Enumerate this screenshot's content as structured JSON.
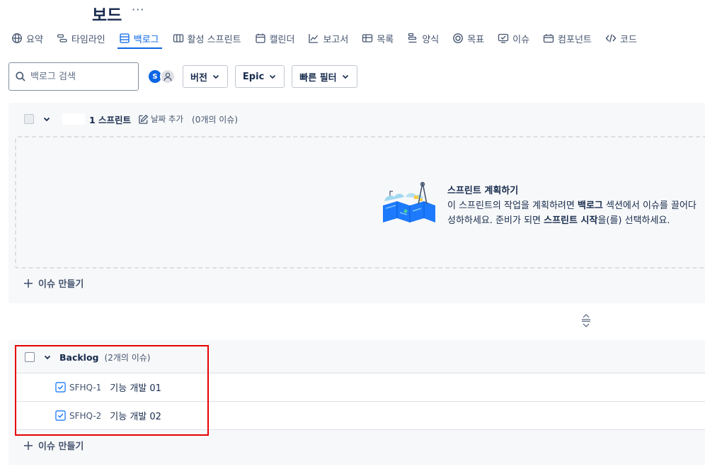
{
  "header": {
    "title": "보드",
    "more": "···"
  },
  "tabs": [
    {
      "label": "요약",
      "icon": "globe-icon"
    },
    {
      "label": "타임라인",
      "icon": "timeline-icon"
    },
    {
      "label": "백로그",
      "icon": "backlog-icon",
      "active": true
    },
    {
      "label": "활성 스프린트",
      "icon": "board-columns-icon"
    },
    {
      "label": "캘린더",
      "icon": "calendar-icon"
    },
    {
      "label": "보고서",
      "icon": "chart-line-icon"
    },
    {
      "label": "목록",
      "icon": "list-icon"
    },
    {
      "label": "양식",
      "icon": "form-icon"
    },
    {
      "label": "목표",
      "icon": "target-icon"
    },
    {
      "label": "이슈",
      "icon": "issue-icon"
    },
    {
      "label": "컴포넌트",
      "icon": "component-icon"
    },
    {
      "label": "코드",
      "icon": "code-icon"
    }
  ],
  "toolbar": {
    "search_placeholder": "백로그 검색",
    "avatar_initial": "S",
    "filters": [
      "버전",
      "Epic",
      "빠른 필터"
    ]
  },
  "sprint": {
    "name": "1 스프린트",
    "date_add": "날짜 추가",
    "count": "(0개의 이슈)",
    "plan_title": "스프린트 계획하기",
    "plan_desc_1": "이 스프린트의 작업을 계획하려면 ",
    "plan_desc_bold_1": "백로그",
    "plan_desc_2": " 섹션에서 이슈를 끌어다",
    "plan_desc_3": "성하하세요. 준비가 되면 ",
    "plan_desc_bold_2": "스프린트 시작",
    "plan_desc_4": "을(를) 선택하세요.",
    "create_issue": "이슈 만들기"
  },
  "backlog": {
    "name": "Backlog",
    "count": "(2개의 이슈)",
    "issues": [
      {
        "key": "SFHQ-1",
        "summary": "기능 개발 01"
      },
      {
        "key": "SFHQ-2",
        "summary": "기능 개발 02"
      }
    ],
    "create_issue": "이슈 만들기"
  },
  "colors": {
    "accent": "#0c66e4",
    "highlight": "#e60000"
  }
}
